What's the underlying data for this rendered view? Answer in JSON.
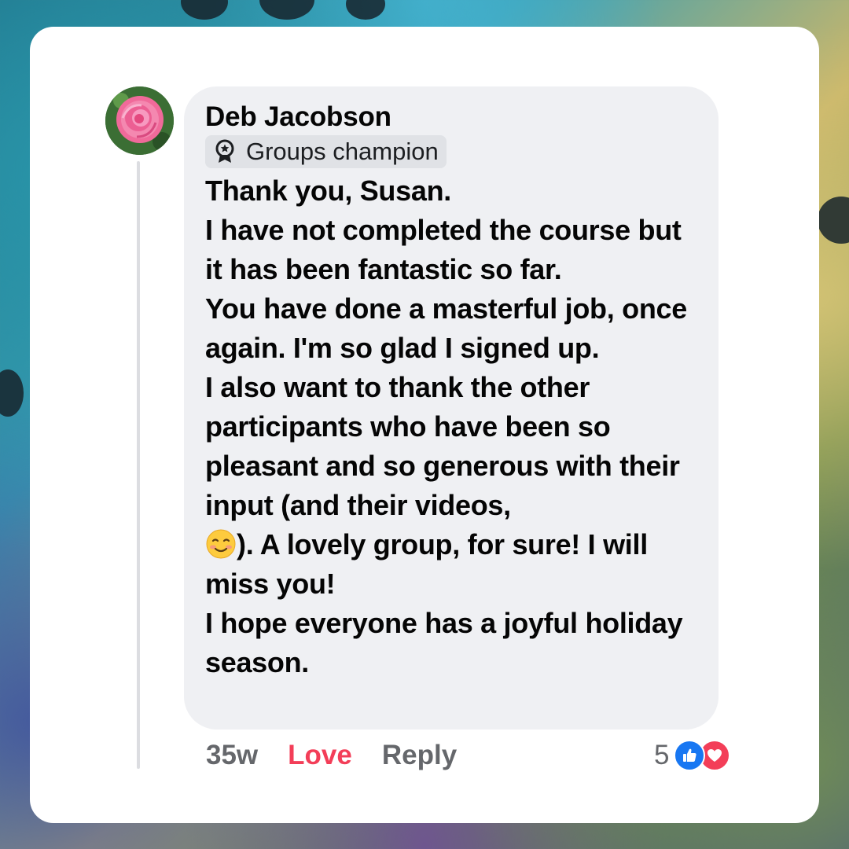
{
  "comment": {
    "author_name": "Deb Jacobson",
    "badge_label": "Groups champion",
    "text_before_emoji": "Thank you, Susan.\nI have not completed the course but it has been fantastic so far.\nYou have done a masterful job, once again. I'm so glad I signed up.\nI also want to thank the other participants who have been so pleasant and so generous with their input (and their videos,\n",
    "emoji": "smiling-face-emoji",
    "text_after_emoji": "). A lovely group, for sure! I will miss you!\nI hope everyone has a joyful holiday season."
  },
  "footer": {
    "timestamp": "35w",
    "love_label": "Love",
    "reply_label": "Reply",
    "reaction_count": "5",
    "reaction_icons": [
      "like-icon",
      "heart-icon"
    ]
  },
  "colors": {
    "bubble_bg": "#eff0f3",
    "love_red": "#f33e58",
    "like_blue": "#1877f2",
    "meta_gray": "#65676b"
  }
}
